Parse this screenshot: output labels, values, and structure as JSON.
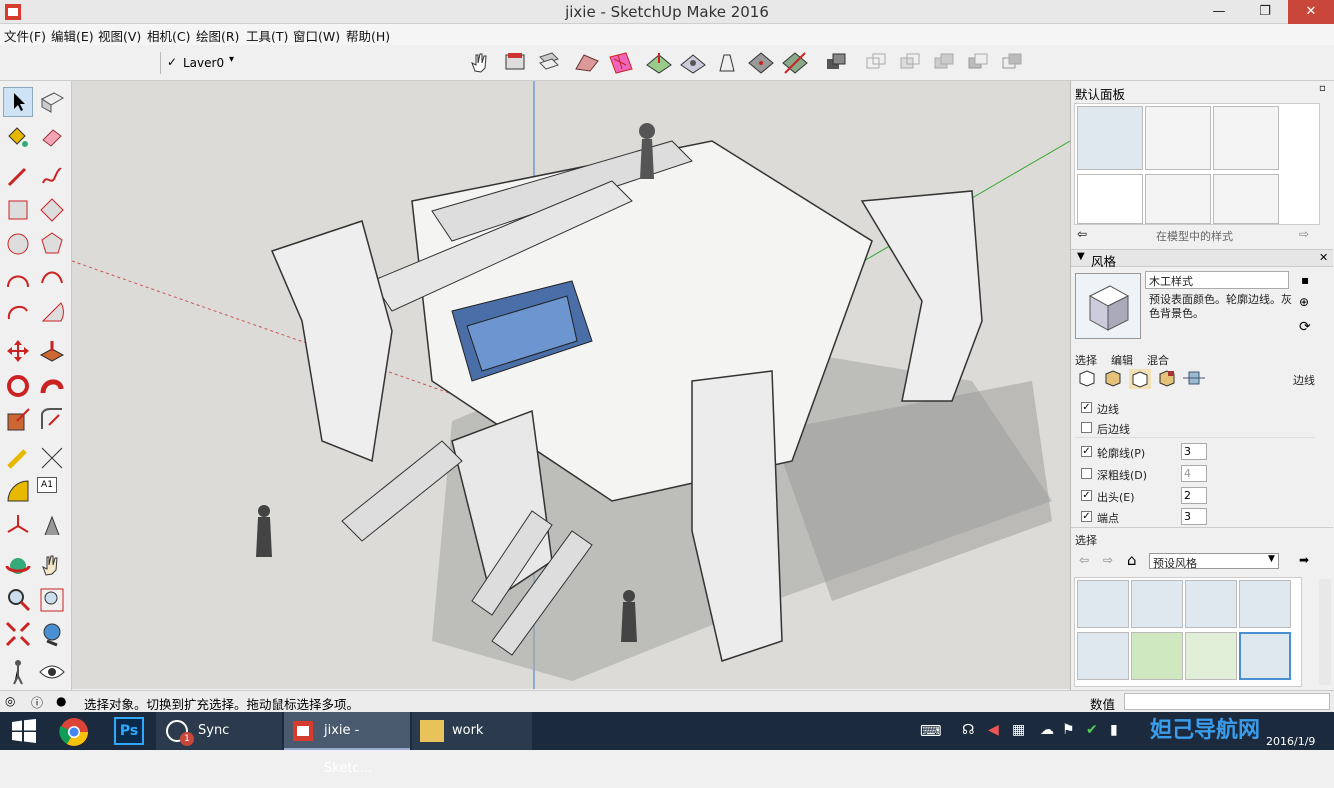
{
  "window": {
    "title": "jixie - SketchUp Make 2016"
  },
  "menu": [
    "文件(F)",
    "编辑(E)",
    "视图(V)",
    "相机(C)",
    "绘图(R)",
    "工具(T)",
    "窗口(W)",
    "帮助(H)"
  ],
  "toolbar": {
    "layer_check": "✓",
    "layer": "Laver0"
  },
  "panel": {
    "title": "默认面板",
    "in_model_label": "在模型中的样式",
    "styles_section": "风格",
    "style_name": "木工样式",
    "style_desc": "预设表面颜色。轮廓边线。灰色背景色。",
    "tabs": [
      "选择",
      "编辑",
      "混合"
    ],
    "edge_label": "边线",
    "options": [
      {
        "label": "边线",
        "checked": true,
        "value": ""
      },
      {
        "label": "后边线",
        "checked": false,
        "value": ""
      },
      {
        "label": "轮廓线(P)",
        "checked": true,
        "value": "3"
      },
      {
        "label": "深粗线(D)",
        "checked": false,
        "value": "4"
      },
      {
        "label": "出头(E)",
        "checked": true,
        "value": "2"
      },
      {
        "label": "端点",
        "checked": true,
        "value": "3"
      }
    ],
    "select_section": "选择",
    "preset_dropdown": "预设风格"
  },
  "status": {
    "message": "选择对象。切换到扩充选择。拖动鼠标选择多项。",
    "value_label": "数值"
  },
  "taskbar": {
    "items": [
      "Sync",
      "jixie - Sketc...",
      "work"
    ],
    "badge": "1",
    "watermark": "妲己导航网",
    "date": "2016/1/9"
  },
  "colors": {
    "accent": "#c8463a",
    "selection": "#cfe3f7",
    "taskbar": "#1b2a3c"
  }
}
